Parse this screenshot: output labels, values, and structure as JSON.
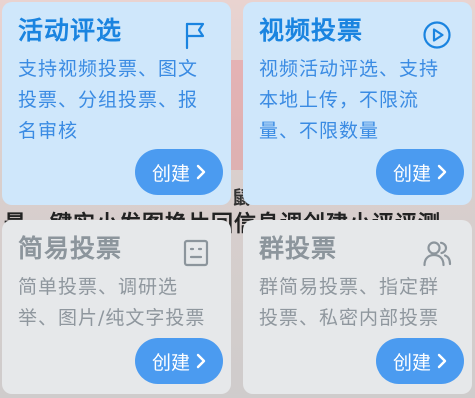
{
  "background": {
    "obscured_line": "最一键实小发图换片回信息调创建小评评测"
  },
  "cards": [
    {
      "title": "活动评选",
      "description": "支持视频投票、图文投票、分组投票、报名审核",
      "button_label": "创建",
      "icon": "flag-icon",
      "state": "active"
    },
    {
      "title": "视频投票",
      "description": "视频活动评选、支持本地上传，不限流量、不限数量",
      "button_label": "创建",
      "icon": "play-circle-icon",
      "state": "active"
    },
    {
      "title": "简易投票",
      "description": "简单投票、调研选举、图片/纯文字投票",
      "button_label": "创建",
      "icon": "list-box-icon",
      "state": "disabled"
    },
    {
      "title": "群投票",
      "description": "群简易投票、指定群投票、私密内部投票",
      "button_label": "创建",
      "icon": "users-icon",
      "state": "disabled"
    }
  ],
  "colors": {
    "active_card_bg": "#cfe7fb",
    "active_text": "#1a84e0",
    "disabled_card_bg": "#e6e8ea",
    "disabled_text": "#8c959c",
    "button_bg": "#4b9bf0"
  }
}
